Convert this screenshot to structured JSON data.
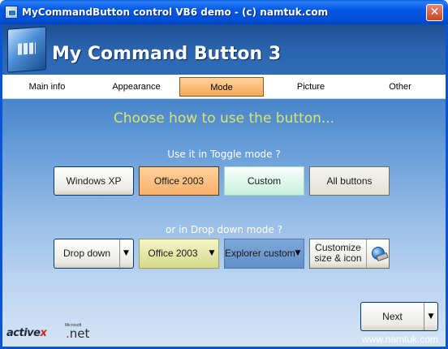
{
  "window": {
    "title": "MyCommandButton control VB6 demo - (c) namtuk.com",
    "close_glyph": "✕"
  },
  "banner": {
    "heading": "My Command Button 3",
    "logo_icon": "app-logo-icon"
  },
  "tabs": [
    {
      "label": "Main info",
      "active": false
    },
    {
      "label": "Appearance",
      "active": false
    },
    {
      "label": "Mode",
      "active": true
    },
    {
      "label": "Picture",
      "active": false
    },
    {
      "label": "Other",
      "active": false
    }
  ],
  "main": {
    "choose_heading": "Choose how to use the button...",
    "toggle_heading": "Use it in Toggle mode ?",
    "toggle_buttons": [
      {
        "label": "Windows XP",
        "style": "winxp"
      },
      {
        "label": "Office 2003",
        "style": "office"
      },
      {
        "label": "Custom",
        "style": "custom"
      },
      {
        "label": "All buttons",
        "style": "allbtn"
      }
    ],
    "dropdown_heading": "or in Drop down mode ?",
    "dropdown_buttons": [
      {
        "label": "Drop down",
        "style": "winxp",
        "arrow": "▼"
      },
      {
        "label": "Office 2003",
        "style": "office",
        "arrow": "▼"
      },
      {
        "label": "Explorer custom",
        "style": "explorer",
        "arrow": "▼"
      },
      {
        "label_line1": "Customize",
        "label_line2": "size & icon",
        "style": "custom",
        "icon": "globe-icon"
      }
    ]
  },
  "footer": {
    "next_label": "Next",
    "next_arrow": "▼",
    "activex_text": "active",
    "activex_x": "x",
    "ms_small": "Microsoft",
    "dotnet_dot": ".",
    "dotnet_text": "net",
    "url": "www.namtuk.com"
  },
  "colors": {
    "titlebar": "#0058e6",
    "choose_heading": "#d7e66a",
    "office_orange": "#f8b06a"
  }
}
